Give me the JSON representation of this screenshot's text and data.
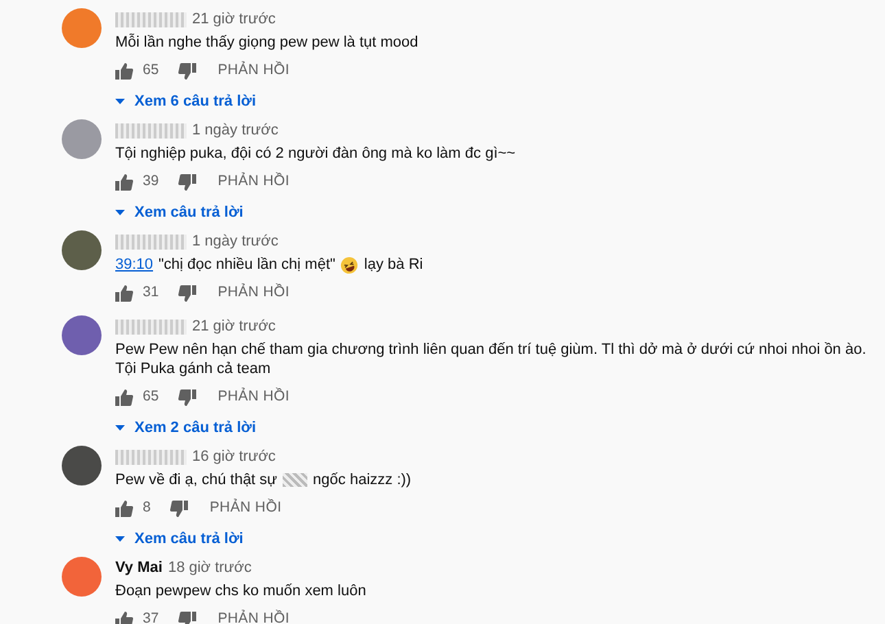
{
  "comments": [
    {
      "color": "#f07a2a",
      "time": "21 giờ trước",
      "text": "Mỗi lần nghe thấy giọng pew pew là tụt mood",
      "likes": "65",
      "reply_label": "PHẢN HỒI",
      "replies": "Xem 6 câu trả lời"
    },
    {
      "color": "#9a9aa2",
      "time": "1 ngày trước",
      "text": "Tội nghiệp puka, đội có 2 người đàn ông mà ko làm đc gì~~",
      "likes": "39",
      "reply_label": "PHẢN HỒI",
      "replies": "Xem câu trả lời"
    },
    {
      "color": "#5d5f4a",
      "time": "1 ngày trước",
      "link": "39:10",
      "text": "\"chị đọc nhiều lần chị mệt\"",
      "emoji": true,
      "text_after": "lạy bà Ri",
      "likes": "31",
      "reply_label": "PHẢN HỒI"
    },
    {
      "color": "#6f5fae",
      "time": "21 giờ trước",
      "text": "Pew Pew nên hạn chế tham gia chương trình liên quan đến trí tuệ giùm. Tl thì dở mà ở dưới cứ nhoi nhoi ồn ào. Tội Puka gánh cả team",
      "likes": "65",
      "reply_label": "PHẢN HỒI",
      "replies": "Xem 2 câu trả lời"
    },
    {
      "color": "#4a4a48",
      "time": "16 giờ trước",
      "text": "Pew về đi ạ, chú thật sự",
      "censored": true,
      "text_after": "ngốc haizzz :))",
      "likes": "8",
      "reply_label": "PHẢN HỒI",
      "replies": "Xem câu trả lời"
    },
    {
      "author": "Vy Mai",
      "color": "#f2643a",
      "time": "18 giờ trước",
      "text": "Đoạn pewpew chs ko muốn xem luôn",
      "likes": "37",
      "reply_label": "PHẢN HỒI"
    }
  ]
}
